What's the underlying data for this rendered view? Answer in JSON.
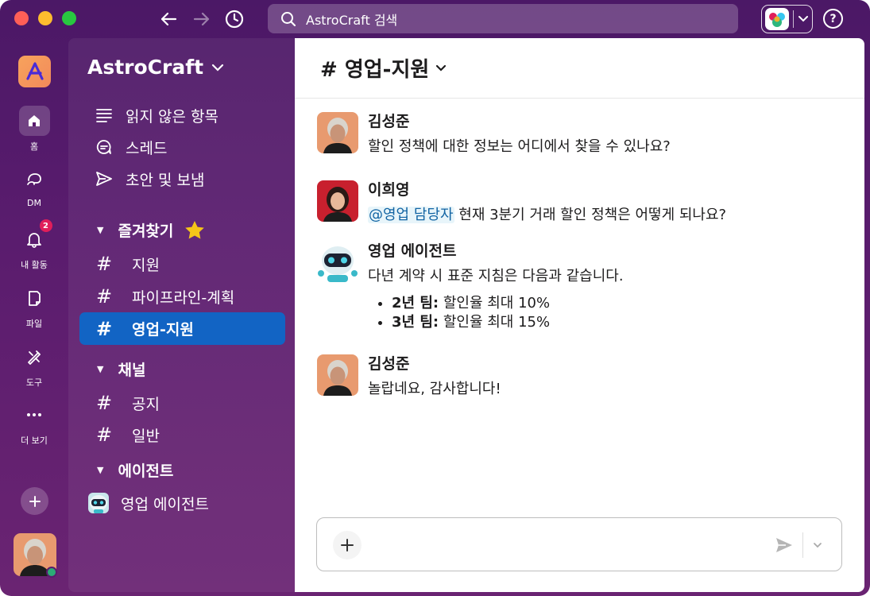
{
  "search": {
    "placeholder": "AstroCraft 검색"
  },
  "rail": {
    "items": [
      {
        "label": "홈",
        "icon": "home-icon"
      },
      {
        "label": "DM",
        "icon": "dm-icon"
      },
      {
        "label": "내 활동",
        "icon": "bell-icon",
        "badge": "2"
      },
      {
        "label": "파일",
        "icon": "files-icon"
      },
      {
        "label": "도구",
        "icon": "tools-icon"
      },
      {
        "label": "더 보기",
        "icon": "more-icon"
      }
    ]
  },
  "sidebar": {
    "workspace_name": "AstroCraft",
    "nav": [
      {
        "label": "읽지 않은 항목",
        "icon": "unreads-icon"
      },
      {
        "label": "스레드",
        "icon": "threads-icon"
      },
      {
        "label": "초안 및 보냄",
        "icon": "send-icon"
      }
    ],
    "favorites": {
      "title": "즐겨찾기",
      "channels": [
        "지원",
        "파이프라인-계획",
        "영업-지원"
      ]
    },
    "channels": {
      "title": "채널",
      "items": [
        "공지",
        "일반"
      ]
    },
    "agents": {
      "title": "에이전트",
      "items": [
        "영업 에이전트"
      ]
    }
  },
  "channel": {
    "name": "# 영업-지원"
  },
  "messages": [
    {
      "sender": "김성준",
      "text": "할인 정책에 대한 정보는 어디에서 찾을 수 있나요?"
    },
    {
      "sender": "이희영",
      "mention": "@영업 담당자",
      "text": " 현재 3분기 거래 할인 정책은 어떻게 되나요?"
    },
    {
      "sender": "영업 에이전트",
      "text": "다년 계약 시 표준 지침은 다음과 같습니다.",
      "bullets": [
        {
          "bold": "2년 팀:",
          "rest": " 할인율 최대 10%"
        },
        {
          "bold": "3년 팀:",
          "rest": " 할인율 최대 15%"
        }
      ]
    },
    {
      "sender": "김성준",
      "text": "놀랍네요, 감사합니다!"
    }
  ],
  "colors": {
    "accent": "#1264c4",
    "sidebar_bg": "#5a1c6e",
    "badge": "#e01e5a",
    "presence": "#2bac76",
    "mention": "#1264a3"
  }
}
